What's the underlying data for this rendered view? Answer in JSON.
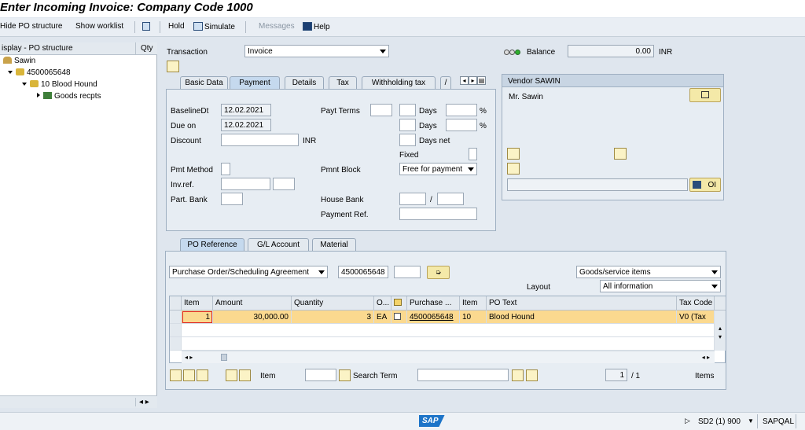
{
  "title": "Enter Incoming Invoice: Company Code 1000",
  "toolbar": {
    "hide_po": "Hide PO structure",
    "show_worklist": "Show worklist",
    "hold": "Hold",
    "simulate": "Simulate",
    "messages": "Messages",
    "help": "Help"
  },
  "tree": {
    "col1": "isplay - PO structure",
    "col2": "Qty",
    "vendor": "Sawin",
    "po": "4500065648",
    "item": "10 Blood Hound",
    "goods": "Goods recpts"
  },
  "header": {
    "transaction_label": "Transaction",
    "transaction_value": "Invoice",
    "balance_label": "Balance",
    "balance_value": "0.00",
    "balance_currency": "INR"
  },
  "tabs": [
    "Basic Data",
    "Payment",
    "Details",
    "Tax",
    "Withholding tax",
    "/"
  ],
  "payment": {
    "baseline_label": "BaselineDt",
    "baseline_value": "12.02.2021",
    "due_label": "Due on",
    "due_value": "12.02.2021",
    "discount_label": "Discount",
    "discount_currency": "INR",
    "pmt_method_label": "Pmt Method",
    "inv_ref_label": "Inv.ref.",
    "part_bank_label": "Part. Bank",
    "payt_terms_label": "Payt Terms",
    "days1": "Days",
    "days2": "Days",
    "days_net": "Days net",
    "pct1": "%",
    "pct2": "%",
    "fixed_label": "Fixed",
    "pmnt_block_label": "Pmnt Block",
    "pmnt_block_value": "Free for payment",
    "house_bank_label": "House Bank",
    "house_bank_sep": "/",
    "payment_ref_label": "Payment Ref."
  },
  "vendor": {
    "title": "Vendor SAWIN",
    "name": "Mr. Sawin",
    "oi_label": "OI"
  },
  "po_tabs": [
    "PO Reference",
    "G/L Account",
    "Material"
  ],
  "po_ref": {
    "doc_type": "Purchase Order/Scheduling Agreement",
    "doc_number": "4500065648",
    "items_select": "Goods/service items",
    "layout_label": "Layout",
    "layout_value": "All information"
  },
  "grid": {
    "headers": [
      "Item",
      "Amount",
      "Quantity",
      "O...",
      "",
      "Purchase ...",
      "Item",
      "PO Text",
      "Tax Code"
    ],
    "rows": [
      [
        "1",
        "30,000.00",
        "3",
        "EA",
        "",
        "4500065648",
        "10",
        "Blood Hound",
        "V0 (Tax"
      ]
    ]
  },
  "bottom": {
    "item_label": "Item",
    "search_label": "Search Term",
    "page_current": "1",
    "page_total": "/ 1",
    "items_label": "Items"
  },
  "status": {
    "system": "SD2 (1) 900",
    "server": "SAPQAL",
    "logo": "SAP"
  }
}
